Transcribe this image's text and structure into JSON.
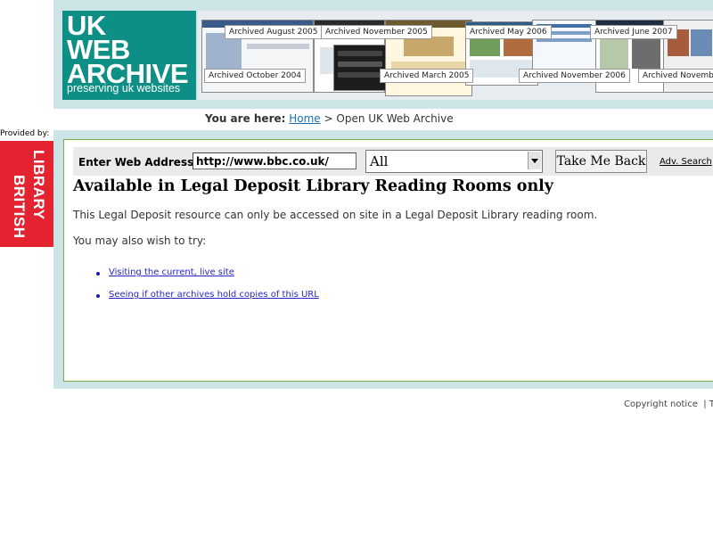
{
  "header": {
    "logo": {
      "line1": "UK",
      "line2": "WEB",
      "line3": "ARCHIVE",
      "tagline": "preserving uk websites"
    },
    "archived_labels": [
      "Archived August 2005",
      "Archived November 2005",
      "Archived May 2006",
      "Archived June 2007",
      "Archived October 2004",
      "Archived March 2005",
      "Archived November 2006",
      "Archived November"
    ]
  },
  "breadcrumb": {
    "prefix": "You are here:",
    "home": "Home",
    "separator": " > ",
    "current": "Open UK Web Archive"
  },
  "provider": {
    "label": "Provided by:",
    "logo_line1": "BRITISH",
    "logo_line2": "LIBRARY"
  },
  "search": {
    "label": "Enter Web Address:",
    "url_value": "http://www.bbc.co.uk/",
    "select_value": "All",
    "submit_label": "Take Me Back",
    "adv_link": "Adv. Search"
  },
  "content": {
    "heading": "Available in Legal Deposit Library Reading Rooms only",
    "paragraph1": "This Legal Deposit resource can only be accessed on site in a Legal Deposit Library reading room.",
    "paragraph2": "You may also wish to try:",
    "links": [
      "Visiting the current, live site",
      "Seeing if other archives hold copies of this URL"
    ]
  },
  "footer": {
    "copyright": "Copyright notice",
    "separator": "|",
    "next": "Te"
  },
  "colors": {
    "logo_teal": "#0d8f86",
    "band": "#cde4e6",
    "bl_red": "#e3232f",
    "panel_border": "#78b04a",
    "link": "#2626c8"
  }
}
